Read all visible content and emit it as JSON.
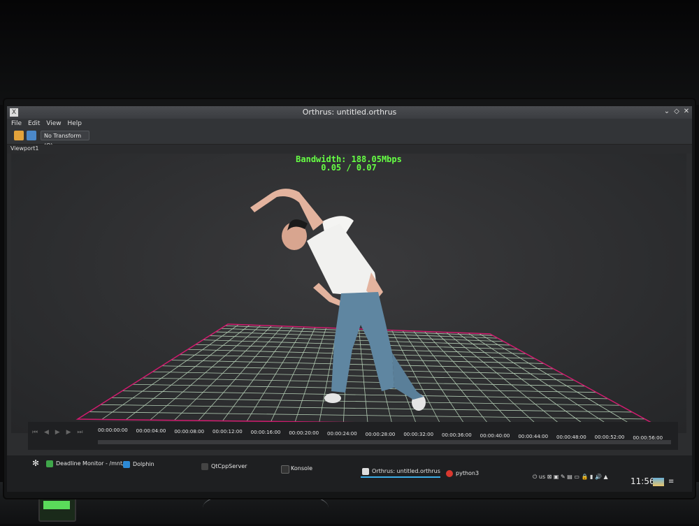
{
  "window": {
    "title": "Orthrus: untitled.orthrus",
    "controls": [
      "chevron-down-icon",
      "diamond-icon",
      "close-icon"
    ]
  },
  "menu": [
    "File",
    "Edit",
    "View",
    "Help"
  ],
  "toolbar": {
    "transform_label": "No Transform (Q)",
    "icons": [
      "folder-open-icon",
      "save-icon"
    ]
  },
  "viewport": {
    "tab_label": "Viewport1",
    "overlay": {
      "bandwidth": "Bandwidth: 188.05Mbps",
      "ratio": "0.05 / 0.07"
    }
  },
  "timeline": {
    "ticks": [
      "00:00:00:00",
      "00:00:04:00",
      "00:00:08:00",
      "00:00:12:00",
      "00:00:16:00",
      "00:00:20:00",
      "00:00:24:00",
      "00:00:28:00",
      "00:00:32:00",
      "00:00:36:00",
      "00:00:40:00",
      "00:00:44:00",
      "00:00:48:00",
      "00:00:52:00",
      "00:00:56:00"
    ]
  },
  "taskbar": {
    "tasks": [
      {
        "label": "Deadline Monitor  - /mnt/...",
        "icon": "deadline-icon"
      },
      {
        "label": "Dolphin",
        "icon": "dolphin-icon"
      },
      {
        "label": "QtCppServer",
        "icon": "terminal-icon"
      },
      {
        "label": "Konsole",
        "icon": "konsole-icon"
      },
      {
        "label": "Orthrus: untitled.orthrus",
        "icon": "orthrus-icon"
      },
      {
        "label": "python3",
        "icon": "python-icon"
      }
    ],
    "layout": "us",
    "clock": "11:56"
  },
  "colors": {
    "overlay_text": "#66ff44",
    "grid_main": "#c9e6c9",
    "grid_edge": "#d11a6e",
    "active_task": "#3daee9"
  }
}
